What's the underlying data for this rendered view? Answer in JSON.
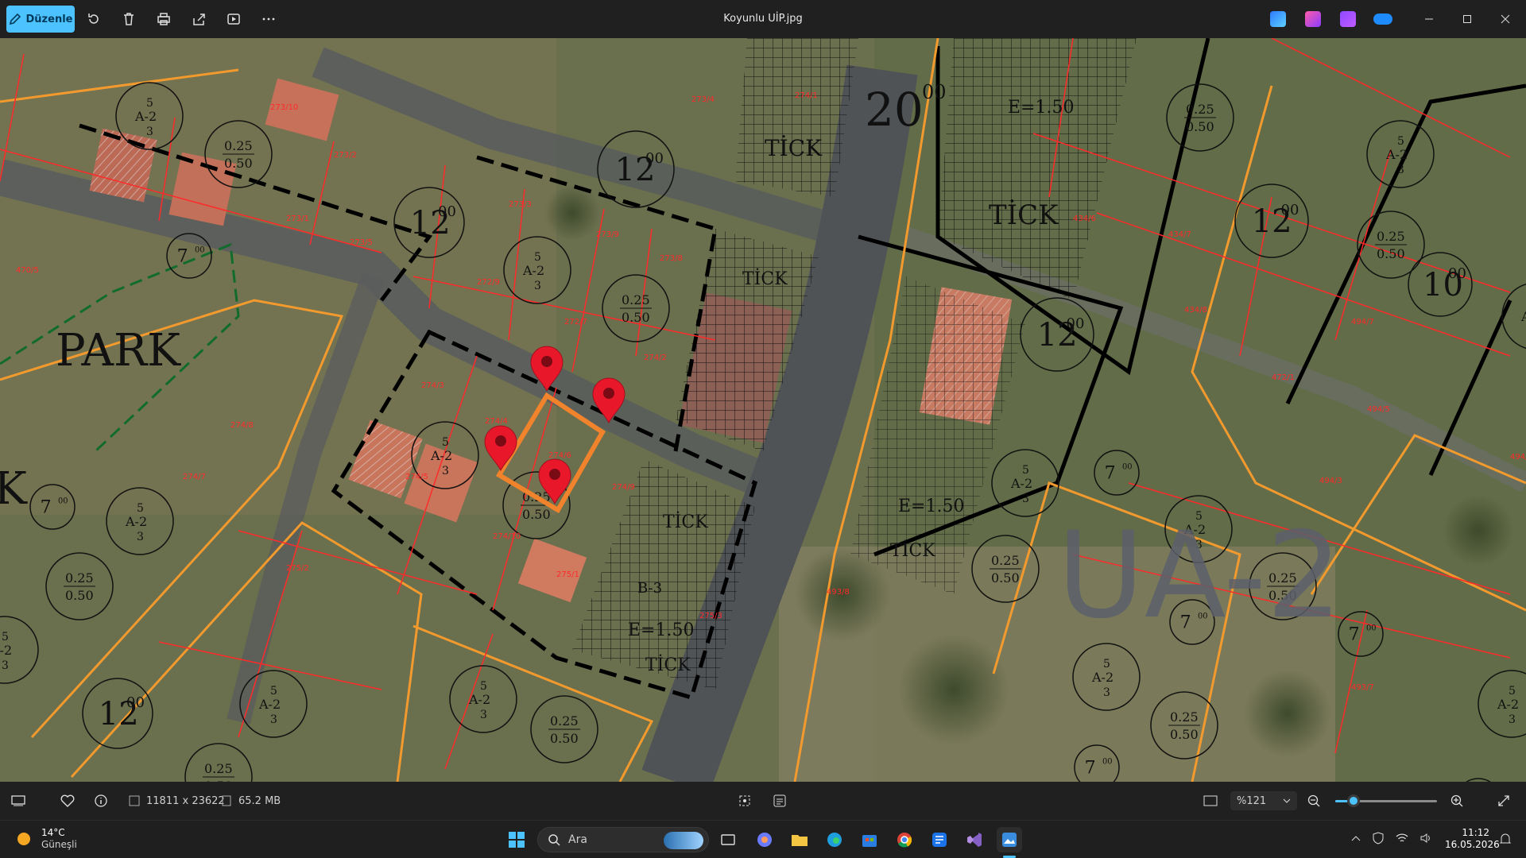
{
  "titlebar": {
    "edit_label": "Düzenle",
    "file_name": "Koyunlu UİP.jpg",
    "tool_icons": [
      "rotate-icon",
      "delete-icon",
      "print-icon",
      "share-icon",
      "slideshow-icon",
      "more-icon"
    ],
    "app_icons": [
      "designer-icon",
      "clipchamp-icon",
      "copilot-icon",
      "onedrive-icon"
    ],
    "window_controls": [
      "minimize-icon",
      "maximize-icon",
      "close-icon"
    ]
  },
  "map": {
    "labels_park": [
      "PARK",
      "K"
    ],
    "zone_label": "UA-2",
    "road_widths": [
      "20",
      "12",
      "12",
      "12",
      "12",
      "10",
      "7",
      "7",
      "7",
      "7",
      "7",
      "7",
      "7"
    ],
    "road_superscript": "00",
    "ratio_top": "0.25",
    "ratio_bottom": "0.50",
    "zone_a2": "A-2",
    "floors_top": "5",
    "floors_bottom": "3",
    "tick_label": "TİCK",
    "tick_labels_alt": [
      "TİCK",
      "TİCK",
      "TİCK",
      "TİCK",
      "TİCK",
      "TİCK"
    ],
    "emsal": "E=1.50",
    "b3": "B-3",
    "parcel_numbers": [
      "273/10",
      "273/2",
      "273/1",
      "273/5",
      "273/3",
      "273/9",
      "273/8",
      "272/9",
      "272/7",
      "273/4",
      "274/1",
      "274/2",
      "274/3",
      "274/4",
      "274/5",
      "274/6",
      "274/7",
      "274/8",
      "274/9",
      "274/10",
      "275/1",
      "275/2",
      "275/3",
      "434/6",
      "434/7",
      "434/8",
      "494/7",
      "494/5",
      "494/3",
      "494/1",
      "493/7",
      "493/8",
      "470/5",
      "472/1"
    ],
    "pin_colors": {
      "pin": "#e8182a",
      "selection": "#f0832b",
      "parcel_line": "#ff2a2a",
      "zone_line": "#f29a2e",
      "block_line": "#000000"
    }
  },
  "statusbar": {
    "dimensions": "11811 x 23622",
    "file_size": "65.2 MB",
    "zoom_level": "%121",
    "zoom_fraction": 0.18
  },
  "taskbar": {
    "weather_temp": "14°C",
    "weather_desc": "Güneşli",
    "search_placeholder": "Ara",
    "time": "11:12",
    "date": "16.05.2026",
    "pinned": [
      "start-icon",
      "search-icon",
      "task-view-icon",
      "copilot-icon",
      "file-explorer-icon",
      "edge-icon",
      "store-icon",
      "chrome-icon",
      "app-icon-blue",
      "visual-studio-icon",
      "photos-icon"
    ]
  }
}
